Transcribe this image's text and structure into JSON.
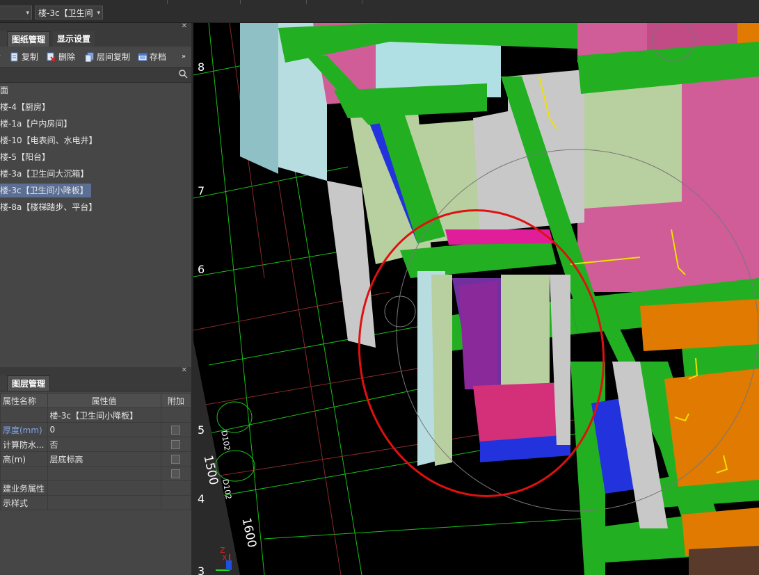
{
  "topbar": {
    "floor_select": "楼-3c【卫生间",
    "colors": {
      "bg": "#2d2d2d"
    }
  },
  "panel_top": {
    "tabs": [
      {
        "label": "图纸管理",
        "active": true
      },
      {
        "label": "显示设置",
        "active": false
      }
    ],
    "toolbar": {
      "copy": "复制",
      "delete": "删除",
      "floor_copy": "层间复制",
      "archive": "存档"
    },
    "search": {
      "placeholder": ""
    },
    "items": [
      {
        "label": "面",
        "selected": false
      },
      {
        "label": "楼-4【厨房】",
        "selected": false
      },
      {
        "label": "楼-1a【户内房间】",
        "selected": false
      },
      {
        "label": "楼-10【电表间、水电井】",
        "selected": false
      },
      {
        "label": "楼-5【阳台】",
        "selected": false
      },
      {
        "label": "楼-3a【卫生间大沉箱】",
        "selected": false
      },
      {
        "label": "楼-3c【卫生间小降板】",
        "selected": true
      },
      {
        "label": "楼-8a【楼梯踏步、平台】",
        "selected": false
      }
    ]
  },
  "panel_props": {
    "tab": "图层管理",
    "headers": {
      "name": "属性名称",
      "value": "属性值",
      "extra": "附加"
    },
    "rows": [
      {
        "name": "",
        "value": "楼-3c【卫生间小降板】",
        "checkbox": false
      },
      {
        "name": "厚度(mm)",
        "value": "0",
        "checkbox": true,
        "blue": true
      },
      {
        "name": "计算防水...",
        "value": "否",
        "checkbox": true
      },
      {
        "name": "高(m)",
        "value": "层底标高",
        "checkbox": true
      },
      {
        "name": "",
        "value": "",
        "checkbox": true
      },
      {
        "name": "建业务属性",
        "value": "",
        "checkbox": false
      },
      {
        "name": "示样式",
        "value": "",
        "checkbox": false
      }
    ]
  },
  "viewport": {
    "axis_labels": [
      "8",
      "7",
      "6",
      "5",
      "4",
      "3"
    ],
    "dims": [
      "1500",
      "1600"
    ],
    "tags": [
      "D102",
      "D102"
    ],
    "gizmo": {
      "x": "X",
      "z": "Z"
    },
    "colors": {
      "beam": "#22b022",
      "pink": "#d4589a",
      "orange": "#e07a00",
      "wall": "#b8cfa0",
      "blue": "#2233dd",
      "grid": "#19c019",
      "highlight": "#e01010"
    }
  }
}
